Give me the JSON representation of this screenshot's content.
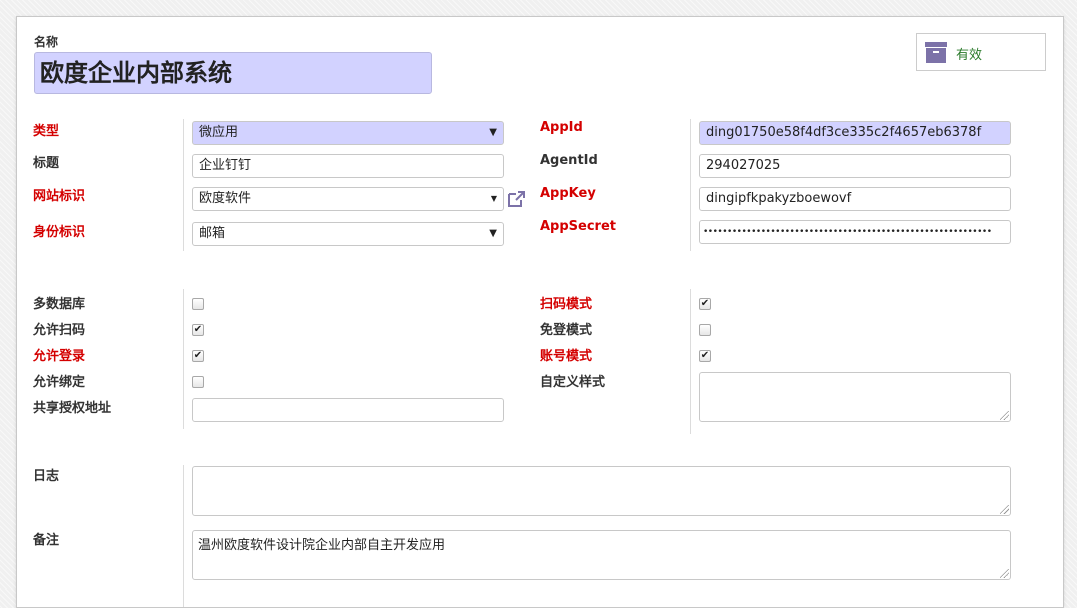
{
  "record": {
    "name_label": "名称",
    "name_value": "欧度企业内部系统",
    "status_button": {
      "label": "有效",
      "icon": "archive-box-icon"
    }
  },
  "fields": {
    "type": {
      "label": "类型",
      "value": "微应用"
    },
    "title": {
      "label": "标题",
      "value": "企业钉钉"
    },
    "website": {
      "label": "网站标识",
      "value": "欧度软件"
    },
    "identity": {
      "label": "身份标识",
      "value": "邮箱"
    },
    "appid": {
      "label": "AppId",
      "value": "ding01750e58f4df3ce335c2f4657eb6378f"
    },
    "agentid": {
      "label": "AgentId",
      "value": "294027025"
    },
    "appkey": {
      "label": "AppKey",
      "value": "dingipfkpakyzboewovf"
    },
    "appsecret": {
      "label": "AppSecret",
      "value": "••••••••••••••••••••••••••••••••••••••••••••••••••••••••••••"
    },
    "multi_db": {
      "label": "多数据库",
      "checked": false
    },
    "allow_scan": {
      "label": "允许扫码",
      "checked": true
    },
    "allow_login": {
      "label": "允许登录",
      "checked": true
    },
    "allow_bind": {
      "label": "允许绑定",
      "checked": false
    },
    "share_auth_url": {
      "label": "共享授权地址",
      "value": ""
    },
    "scan_mode": {
      "label": "扫码模式",
      "checked": true
    },
    "nologin_mode": {
      "label": "免登模式",
      "checked": false
    },
    "account_mode": {
      "label": "账号模式",
      "checked": true
    },
    "custom_style": {
      "label": "自定义样式",
      "value": ""
    },
    "log": {
      "label": "日志",
      "value": ""
    },
    "note": {
      "label": "备注",
      "value": "温州欧度软件设计院企业内部自主开发应用"
    }
  },
  "colors": {
    "required_label": "#d40000",
    "highlight_bg": "#d2d2ff",
    "status_text": "#2a7a2a",
    "icon": "#7c72a8"
  }
}
